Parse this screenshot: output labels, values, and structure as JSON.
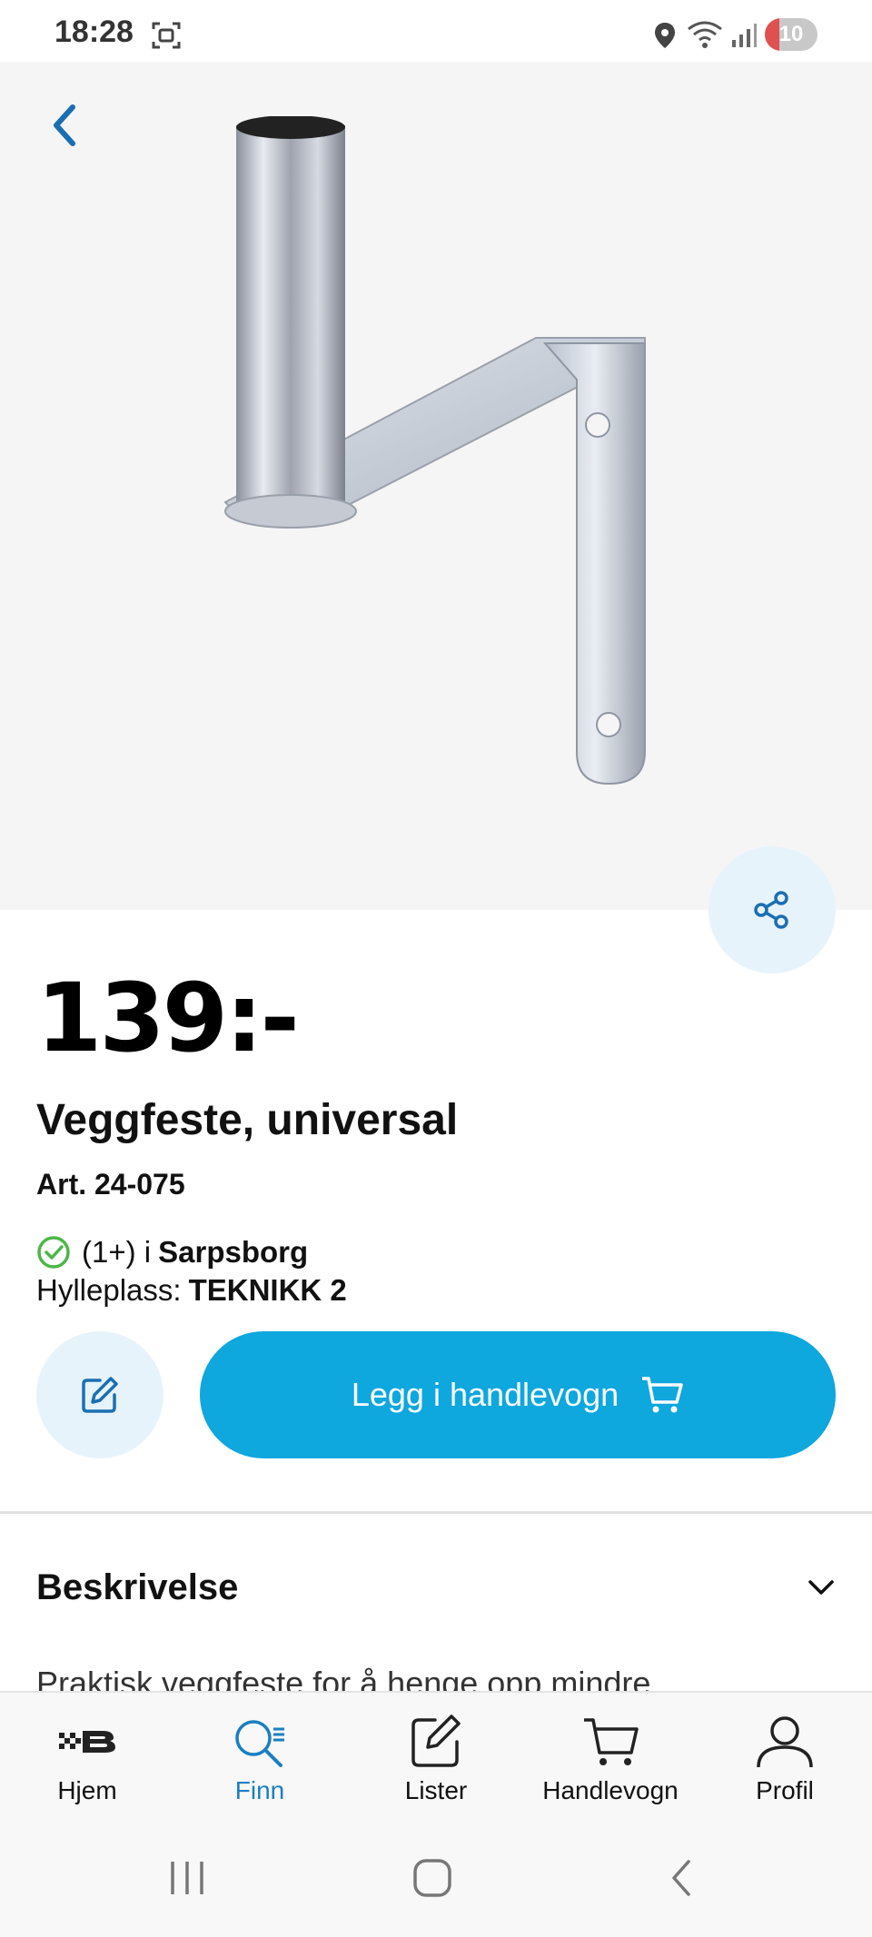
{
  "status_bar": {
    "time": "18:28",
    "battery_level": "10",
    "icons": [
      "screenshot-icon",
      "location-icon",
      "wifi-icon",
      "signal-icon",
      "battery-icon"
    ]
  },
  "product": {
    "price": "139:-",
    "name": "Veggfeste, universal",
    "article": "Art. 24-075",
    "stock_count": "(1+) i",
    "store": "Sarpsborg",
    "shelf_label": "Hylleplass:",
    "shelf_value": "TEKNIKK 2"
  },
  "actions": {
    "add_to_cart": "Legg i handlevogn"
  },
  "description": {
    "heading": "Beskrivelse",
    "text": "Praktisk veggfeste for å henge opp mindre"
  },
  "bottom_nav": {
    "items": [
      {
        "label": "Hjem",
        "icon": "home-logo-icon"
      },
      {
        "label": "Finn",
        "icon": "search-icon"
      },
      {
        "label": "Lister",
        "icon": "edit-list-icon"
      },
      {
        "label": "Handlevogn",
        "icon": "cart-icon"
      },
      {
        "label": "Profil",
        "icon": "profile-icon"
      }
    ],
    "active": "Finn"
  },
  "colors": {
    "accent": "#0ea7de",
    "accent_light": "#e6f3fb",
    "link_blue": "#1a7fc1",
    "stock_green": "#4cb648"
  }
}
